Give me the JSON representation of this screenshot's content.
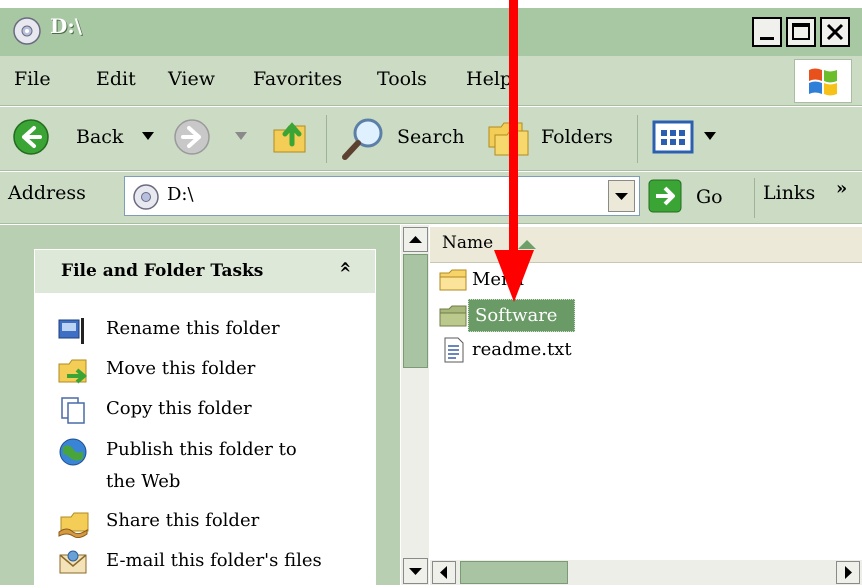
{
  "window": {
    "title": "D:\\"
  },
  "menu": {
    "items": [
      "File",
      "Edit",
      "View",
      "Favorites",
      "Tools",
      "Help"
    ]
  },
  "toolbar": {
    "back_label": "Back",
    "search_label": "Search",
    "folders_label": "Folders"
  },
  "address": {
    "label": "Address",
    "value": "D:\\",
    "go_label": "Go",
    "links_label": "Links",
    "links_chevron": "»"
  },
  "tasks": {
    "title": "File and Folder Tasks",
    "collapse_glyph": "«",
    "items": [
      "Rename this folder",
      "Move this folder",
      "Copy this folder",
      "Publish this folder to",
      "the Web",
      "Share this folder",
      "E-mail this folder's files"
    ]
  },
  "files": {
    "column_header": "Name",
    "items": [
      "Menu",
      "Software",
      "readme.txt"
    ]
  },
  "colors": {
    "chrome": "#ccdcc4",
    "title_bar": "#a8c8a4",
    "selection": "#6a9a66",
    "arrow": "#ff0000"
  }
}
